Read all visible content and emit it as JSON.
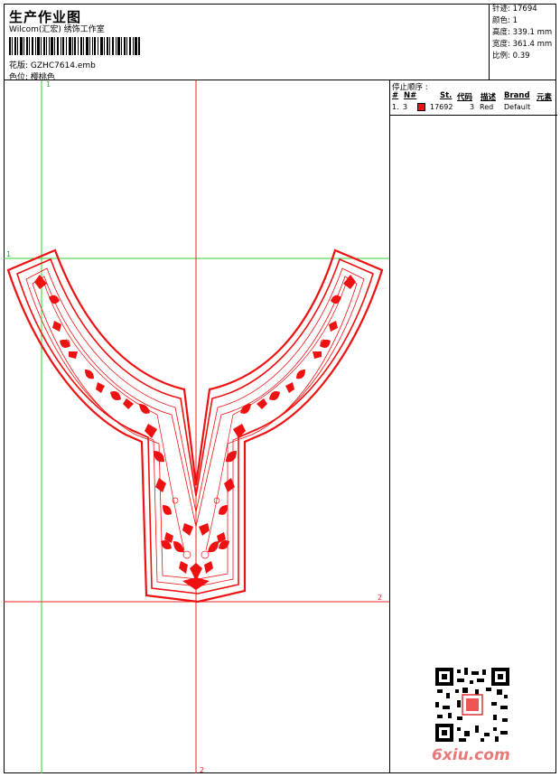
{
  "header": {
    "title": "生产作业图",
    "studio": "Wilcom(汇宏) 绣饰工作室",
    "filename_label": "花版:",
    "filename": "GZHC7614.emb",
    "colorway_label": "色位:",
    "colorway": "樱桃色"
  },
  "stats": [
    {
      "label": "针迹",
      "value": "17694"
    },
    {
      "label": "颜色",
      "value": "1"
    },
    {
      "label": "高度",
      "value": "339.1 mm"
    },
    {
      "label": "宽度",
      "value": "361.4 mm"
    },
    {
      "label": "比例",
      "value": "0.39"
    }
  ],
  "stop_sequence": {
    "title": "停止顺序 :",
    "columns": [
      "#",
      "N#",
      "St.",
      "代码",
      "描述",
      "Brand",
      "元素"
    ],
    "rows": [
      {
        "num": "1.",
        "needle": "3",
        "swatch_color": "#ee1111",
        "stitches": "17692",
        "code": "3",
        "description": "Red",
        "brand": "Default",
        "element": ""
      }
    ]
  },
  "guides": {
    "v1_label": "1",
    "h1_label": "1",
    "h2_label": "2",
    "v2_label": "2"
  },
  "colors": {
    "thread": "#ee1111",
    "guide_green": "#33cc33",
    "guide_red": "#ee2222"
  },
  "watermark": "6xiu.com"
}
